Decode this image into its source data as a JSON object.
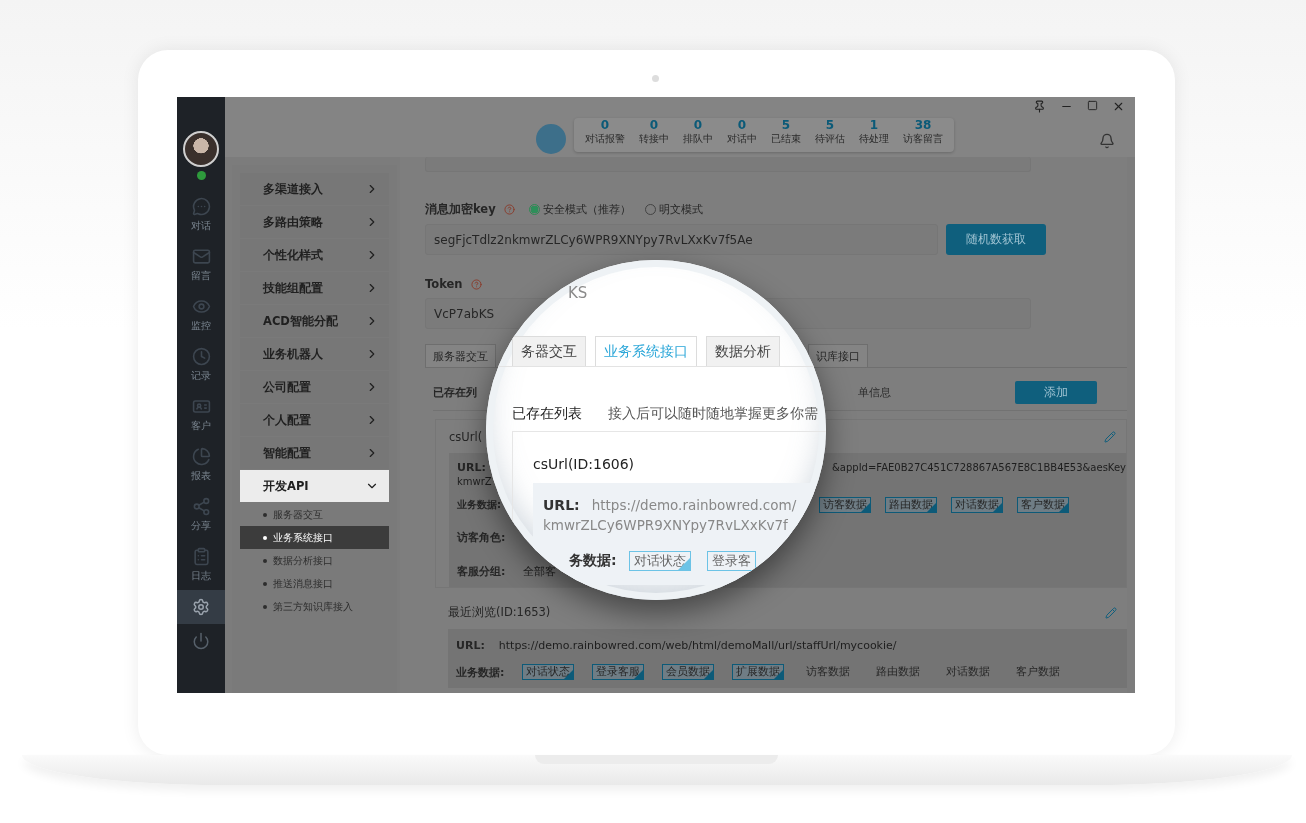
{
  "rail": {
    "items": [
      {
        "label": "对话",
        "selected": false
      },
      {
        "label": "留言",
        "selected": false
      },
      {
        "label": "监控",
        "selected": false
      },
      {
        "label": "记录",
        "selected": false
      },
      {
        "label": "客户",
        "selected": false
      },
      {
        "label": "报表",
        "selected": false
      },
      {
        "label": "分享",
        "selected": false
      },
      {
        "label": "日志",
        "selected": false
      }
    ],
    "settings": {
      "selected": true
    }
  },
  "stats": [
    {
      "value": "0",
      "label": "对话报警"
    },
    {
      "value": "0",
      "label": "转接中"
    },
    {
      "value": "0",
      "label": "排队中"
    },
    {
      "value": "0",
      "label": "对话中"
    },
    {
      "value": "5",
      "label": "已结束"
    },
    {
      "value": "5",
      "label": "待评估"
    },
    {
      "value": "1",
      "label": "待处理"
    },
    {
      "value": "38",
      "label": "访客留言"
    }
  ],
  "menu": [
    {
      "label": "多渠道接入",
      "expanded": false
    },
    {
      "label": "多路由策略",
      "expanded": false
    },
    {
      "label": "个性化样式",
      "expanded": false
    },
    {
      "label": "技能组配置",
      "expanded": false
    },
    {
      "label": "ACD智能分配",
      "expanded": false
    },
    {
      "label": "业务机器人",
      "expanded": false
    },
    {
      "label": "公司配置",
      "expanded": false
    },
    {
      "label": "个人配置",
      "expanded": false
    },
    {
      "label": "智能配置",
      "expanded": false
    },
    {
      "label": "开发API",
      "expanded": true,
      "children": [
        {
          "label": "服务器交互",
          "selected": false
        },
        {
          "label": "业务系统接口",
          "selected": true
        },
        {
          "label": "数据分析接口",
          "selected": false
        },
        {
          "label": "推送消息接口",
          "selected": false
        },
        {
          "label": "第三方知识库接入",
          "selected": false
        }
      ]
    }
  ],
  "encryption": {
    "label": "消息加密key",
    "options": [
      {
        "label": "安全模式（推荐）",
        "selected": true
      },
      {
        "label": "明文模式",
        "selected": false
      }
    ],
    "value": "segFjcTdlz2nkmwrZLCy6WPR9XNYpy7RvLXxKv7f5Ae",
    "button": "随机数获取"
  },
  "token": {
    "label": "Token",
    "value": "VcP7abKS"
  },
  "tabs": [
    {
      "label": "服务器交互",
      "selected": false
    },
    {
      "label": "识库接口",
      "selected": false
    }
  ],
  "list": {
    "title": "已存在列",
    "hint": "单信息",
    "add_button": "添加",
    "entry_1": {
      "title": "csUrl(",
      "url_label": "URL:",
      "url_tail": "&appId=FAE0B27C451C728867A567E8C1BB4E53&aesKey",
      "url_line_2": "kmwrZ",
      "data_label": "业务数据:",
      "tags": [
        {
          "label": "访客数据",
          "checked": true
        },
        {
          "label": "路由数据",
          "checked": true
        },
        {
          "label": "对话数据",
          "checked": true
        },
        {
          "label": "客户数据",
          "checked": true
        }
      ],
      "role_label": "访客角色:",
      "group_label": "客服分组:",
      "group_value": "全部客"
    },
    "entry_2": {
      "title": "最近浏览(ID:1653)",
      "url_label": "URL:",
      "url": "https://demo.rainbowred.com/web/html/demoMall/url/staffUrl/mycookie/",
      "data_label": "业务数据:",
      "tags": [
        {
          "label": "对话状态",
          "checked": true
        },
        {
          "label": "登录客服",
          "checked": true
        },
        {
          "label": "会员数据",
          "checked": true
        },
        {
          "label": "扩展数据",
          "checked": true
        },
        {
          "label": "访客数据",
          "checked": false
        },
        {
          "label": "路由数据",
          "checked": false
        },
        {
          "label": "对话数据",
          "checked": false
        },
        {
          "label": "客户数据",
          "checked": false
        }
      ]
    }
  },
  "magnifier": {
    "token_fragment": "KS",
    "tabs": [
      {
        "label": "务器交互",
        "selected": false
      },
      {
        "label": "业务系统接口",
        "selected": true
      },
      {
        "label": "数据分析",
        "selected": false
      }
    ],
    "list_title": "已存在列表",
    "hint": "接入后可以随时随地掌握更多你需",
    "entry_title": "csUrl(ID:1606)",
    "url_label": "URL:",
    "url_lines": [
      "https://demo.rainbowred.com/",
      "kmwrZLCy6WPR9XNYpy7RvLXxKv7f"
    ],
    "data_label": "务数据:",
    "tags": [
      {
        "label": "对话状态",
        "checked": true
      },
      {
        "label": "登录客",
        "checked": false
      }
    ]
  }
}
